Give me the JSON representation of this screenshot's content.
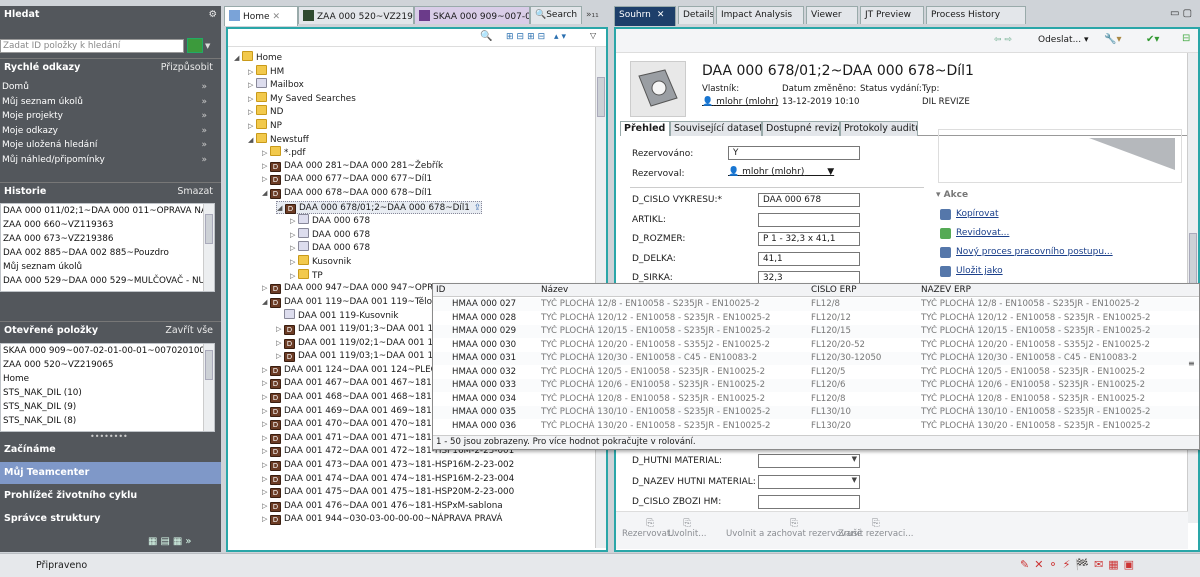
{
  "left": {
    "search_title": "Hledat",
    "search_placeholder": "Zadat ID položky k hledání",
    "quick_title": "Rychlé odkazy",
    "quick_customize": "Přizpůsobit",
    "quick_links": [
      "Domů",
      "Můj seznam úkolů",
      "Moje projekty",
      "Moje odkazy",
      "Moje uložená hledání",
      "Můj náhled/připomínky"
    ],
    "history_title": "Historie",
    "history_clear": "Smazat",
    "history": [
      "DAA 000 011/02;1~DAA 000 011~OPRAVA NÁPRA",
      "ZAA 000 660~VZ119363",
      "ZAA 000 673~VZ219386",
      "DAA 002 885~DAA 002 885~Pouzdro",
      "Můj seznam úkolů",
      "DAA 000 529~DAA 000 529~MULČOVAČ - NUD 16"
    ],
    "open_title": "Otevřené položky",
    "open_close": "Zavřít vše",
    "open_items": [
      "SKAA 000 909~007-02-01-00-01~00702010001",
      "ZAA 000 520~VZ219065",
      "Home",
      "STS_NAK_DIL (10)",
      "STS_NAK_DIL (9)",
      "STS_NAK_DIL (8)"
    ],
    "nav": [
      "Začínáme",
      "Můj Teamcenter",
      "Prohlížeč životního cyklu",
      "Správce struktury"
    ]
  },
  "mid_tabs": [
    "Home",
    "ZAA 000 520~VZ219065",
    "SKAA 000 909~007-02-",
    "Search"
  ],
  "tree": [
    {
      "d": 0,
      "t": "Home",
      "ic": "home",
      "tw": "◢"
    },
    {
      "d": 1,
      "t": "HM",
      "ic": "folder",
      "tw": "▷"
    },
    {
      "d": 1,
      "t": "Mailbox",
      "ic": "mail",
      "tw": "▷"
    },
    {
      "d": 1,
      "t": "My Saved Searches",
      "ic": "folder",
      "tw": "▷"
    },
    {
      "d": 1,
      "t": "ND",
      "ic": "folder",
      "tw": "▷"
    },
    {
      "d": 1,
      "t": "NP",
      "ic": "folder",
      "tw": "▷"
    },
    {
      "d": 1,
      "t": "Newstuff",
      "ic": "folder",
      "tw": "◢"
    },
    {
      "d": 2,
      "t": "*.pdf",
      "ic": "pdf",
      "tw": "▷"
    },
    {
      "d": 2,
      "t": "DAA 000 281~DAA 000 281~Žebřík",
      "ic": "item",
      "tw": "▷"
    },
    {
      "d": 2,
      "t": "DAA 000 677~DAA 000 677~Díl1",
      "ic": "item",
      "tw": "▷"
    },
    {
      "d": 2,
      "t": "DAA 000 678~DAA 000 678~Díl1",
      "ic": "item",
      "tw": "◢"
    },
    {
      "d": 3,
      "t": "DAA 000 678/01;2~DAA 000 678~Díl1",
      "ic": "item",
      "tw": "◢",
      "sel": true
    },
    {
      "d": 4,
      "t": "DAA 000 678",
      "ic": "rev",
      "tw": "▷"
    },
    {
      "d": 4,
      "t": "DAA 000 678",
      "ic": "rev",
      "tw": "▷"
    },
    {
      "d": 4,
      "t": "DAA 000 678",
      "ic": "rev",
      "tw": "▷"
    },
    {
      "d": 4,
      "t": "Kusovnik",
      "ic": "folder",
      "tw": "▷"
    },
    {
      "d": 4,
      "t": "TP",
      "ic": "folder",
      "tw": "▷"
    },
    {
      "d": 2,
      "t": "DAA 000 947~DAA 000 947~OPRA",
      "ic": "item",
      "tw": "▷"
    },
    {
      "d": 2,
      "t": "DAA 001 119~DAA 001 119~Tělo 1",
      "ic": "item",
      "tw": "◢"
    },
    {
      "d": 3,
      "t": "DAA 001 119-Kusovnik",
      "ic": "rev",
      "tw": ""
    },
    {
      "d": 3,
      "t": "DAA 001 119/01;3~DAA 001 11",
      "ic": "item",
      "tw": "▷"
    },
    {
      "d": 3,
      "t": "DAA 001 119/02;1~DAA 001 11",
      "ic": "item",
      "tw": "▷"
    },
    {
      "d": 3,
      "t": "DAA 001 119/03;1~DAA 001 11",
      "ic": "item",
      "tw": "▷"
    },
    {
      "d": 2,
      "t": "DAA 001 124~DAA 001 124~PLECH",
      "ic": "item",
      "tw": "▷"
    },
    {
      "d": 2,
      "t": "DAA 001 467~DAA 001 467~181-H",
      "ic": "item",
      "tw": "▷"
    },
    {
      "d": 2,
      "t": "DAA 001 468~DAA 001 468~181-H",
      "ic": "item",
      "tw": "▷"
    },
    {
      "d": 2,
      "t": "DAA 001 469~DAA 001 469~181-H",
      "ic": "item",
      "tw": "▷"
    },
    {
      "d": 2,
      "t": "DAA 001 470~DAA 001 470~181-H",
      "ic": "item",
      "tw": "▷"
    },
    {
      "d": 2,
      "t": "DAA 001 471~DAA 001 471~181-H",
      "ic": "item",
      "tw": "▷"
    },
    {
      "d": 2,
      "t": "DAA 001 472~DAA 001 472~181-HSP16M-2-23-001",
      "ic": "item",
      "tw": "▷"
    },
    {
      "d": 2,
      "t": "DAA 001 473~DAA 001 473~181-HSP16M-2-23-002",
      "ic": "item",
      "tw": "▷"
    },
    {
      "d": 2,
      "t": "DAA 001 474~DAA 001 474~181-HSP16M-2-23-004",
      "ic": "item",
      "tw": "▷"
    },
    {
      "d": 2,
      "t": "DAA 001 475~DAA 001 475~181-HSP20M-2-23-000",
      "ic": "item",
      "tw": "▷"
    },
    {
      "d": 2,
      "t": "DAA 001 476~DAA 001 476~181-HSPxM-sablona",
      "ic": "item",
      "tw": "▷"
    },
    {
      "d": 2,
      "t": "DAA 001 944~030-03-00-00-00~NÁPRAVA PRAVÁ",
      "ic": "item",
      "tw": "▷"
    }
  ],
  "right_tabs": [
    "Souhrn",
    "Details",
    "Impact Analysis",
    "Viewer",
    "JT Preview",
    "Process History"
  ],
  "right": {
    "send": "Odeslat...",
    "title": "DAA 000 678/01;2~DAA 000 678~Díl1",
    "owner_label": "Vlastník:",
    "owner": "mlohr (mlohr)",
    "date_label": "Datum změněno:",
    "date": "13-12-2019 10:10",
    "status_label": "Status vydání:",
    "type_label": "Typ:",
    "type": "DIL REVIZE",
    "subtabs": [
      "Přehled",
      "Související datasety",
      "Dostupné revize",
      "Protokoly auditu"
    ],
    "rez_label": "Rezervováno:",
    "rez_val": "Y",
    "rezby_label": "Rezervoval:",
    "rezby_val": "mlohr (mlohr)",
    "fields": [
      {
        "l": "D_CISLO VYKRESU:*",
        "v": "DAA 000 678"
      },
      {
        "l": "ARTIKL:",
        "v": ""
      },
      {
        "l": "D_ROZMER:",
        "v": "P 1 - 32,3 x 41,1"
      },
      {
        "l": "D_DELKA:",
        "v": "41,1"
      },
      {
        "l": "D_SIRKA:",
        "v": "32,3"
      }
    ],
    "lower_fields": [
      {
        "l": "D_HUTNI MATERIAL:",
        "v": ""
      },
      {
        "l": "D_NAZEV HUTNI MATERIAL:",
        "v": ""
      },
      {
        "l": "D_CISLO ZBOZI HM:",
        "v": ""
      }
    ],
    "actions_title": "Akce",
    "actions": [
      "Kopírovat",
      "Revidovat...",
      "Nový proces pracovního postupu...",
      "Uložit jako"
    ],
    "bottom": [
      "Rezervovat...",
      "Uvolnit...",
      "Uvolnit a zachovat rezervované",
      "Zrušit rezervaci..."
    ]
  },
  "popup": {
    "headers": [
      "ID",
      "Název",
      "CISLO ERP",
      "NAZEV ERP"
    ],
    "rows": [
      [
        "HMAA 000 027",
        "TYČ PLOCHÁ 12/8 - EN10058 - S235JR - EN10025-2",
        "FL12/8",
        "TYČ PLOCHÁ 12/8 - EN10058 - S235JR - EN10025-2"
      ],
      [
        "HMAA 000 028",
        "TYČ PLOCHÁ 120/12 - EN10058 - S235JR - EN10025-2",
        "FL120/12",
        "TYČ PLOCHÁ 120/12 - EN10058 - S235JR - EN10025-2"
      ],
      [
        "HMAA 000 029",
        "TYČ PLOCHÁ 120/15 - EN10058 - S235JR - EN10025-2",
        "FL120/15",
        "TYČ PLOCHÁ 120/15 - EN10058 - S235JR - EN10025-2"
      ],
      [
        "HMAA 000 030",
        "TYČ PLOCHÁ 120/20 - EN10058 - S355J2 - EN10025-2",
        "FL120/20-52",
        "TYČ PLOCHÁ 120/20 - EN10058 - S355J2 - EN10025-2"
      ],
      [
        "HMAA 000 031",
        "TYČ PLOCHÁ 120/30 - EN10058 - C45 - EN10083-2",
        "FL120/30-12050",
        "TYČ PLOCHÁ 120/30 - EN10058 - C45 - EN10083-2"
      ],
      [
        "HMAA 000 032",
        "TYČ PLOCHÁ 120/5 - EN10058 - S235JR - EN10025-2",
        "FL120/5",
        "TYČ PLOCHÁ 120/5 - EN10058 - S235JR - EN10025-2"
      ],
      [
        "HMAA 000 033",
        "TYČ PLOCHÁ 120/6 - EN10058 - S235JR - EN10025-2",
        "FL120/6",
        "TYČ PLOCHÁ 120/6 - EN10058 - S235JR - EN10025-2"
      ],
      [
        "HMAA 000 034",
        "TYČ PLOCHÁ 120/8 - EN10058 - S235JR - EN10025-2",
        "FL120/8",
        "TYČ PLOCHÁ 120/8 - EN10058 - S235JR - EN10025-2"
      ],
      [
        "HMAA 000 035",
        "TYČ PLOCHÁ 130/10 - EN10058 - S235JR - EN10025-2",
        "FL130/10",
        "TYČ PLOCHÁ 130/10 - EN10058 - S235JR - EN10025-2"
      ],
      [
        "HMAA 000 036",
        "TYČ PLOCHÁ 130/20 - EN10058 - S235JR - EN10025-2",
        "FL130/20",
        "TYČ PLOCHÁ 130/20 - EN10058 - S235JR - EN10025-2"
      ]
    ],
    "footer": "1 - 50 jsou zobrazeny. Pro více hodnot pokračujte v rolování."
  },
  "status": {
    "text": "Připraveno"
  },
  "colors": {
    "accent": "#2aa6a8",
    "nav_bg": "#53575c",
    "nav_sel": "#7f98c8",
    "item_icon": "#6b3b24"
  }
}
